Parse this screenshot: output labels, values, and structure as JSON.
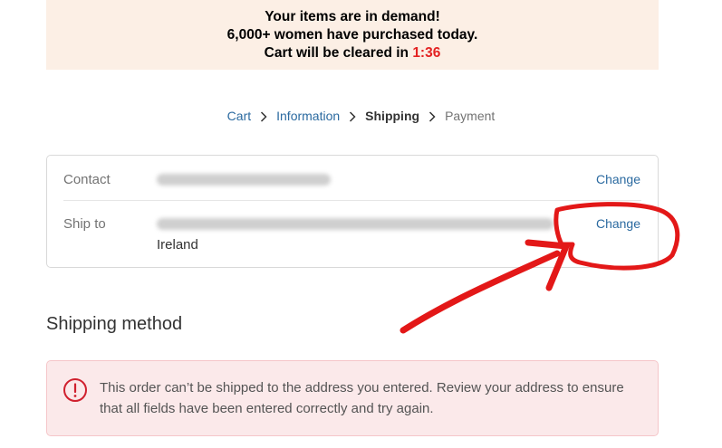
{
  "banner": {
    "line1": "Your items are in demand!",
    "line2": "6,000+ women have purchased today.",
    "line3_prefix": "Cart will be cleared in ",
    "timer": "1:36"
  },
  "breadcrumb": {
    "items": [
      {
        "label": "Cart",
        "state": "link"
      },
      {
        "label": "Information",
        "state": "link"
      },
      {
        "label": "Shipping",
        "state": "current"
      },
      {
        "label": "Payment",
        "state": "future"
      }
    ],
    "separator_icon": "chevron-right-icon"
  },
  "review": {
    "contact": {
      "label": "Contact",
      "change_label": "Change"
    },
    "ship_to": {
      "label": "Ship to",
      "country": "Ireland",
      "change_label": "Change"
    }
  },
  "shipping_method": {
    "title": "Shipping method",
    "error_icon": "alert-circle-icon",
    "error_message": "This order can’t be shipped to the address you entered. Review your address to ensure that all fields have been entered correctly and try again."
  },
  "colors": {
    "banner_bg": "#fcefe5",
    "timer": "#e32222",
    "link": "#2b6aa0",
    "error_bg": "#fbe9ea",
    "error_icon": "#d0202e",
    "annotation": "#e31818"
  }
}
